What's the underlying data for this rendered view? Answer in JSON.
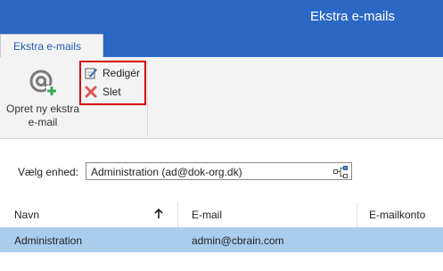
{
  "window": {
    "title": "Ekstra e-mails"
  },
  "tabs": [
    {
      "label": "Ekstra e-mails",
      "active": true
    }
  ],
  "ribbon": {
    "new_button": {
      "label": "Opret ny ekstra e-mail",
      "icon": "at-plus-icon"
    },
    "edit_button": {
      "label": "Redigér",
      "icon": "edit-icon"
    },
    "delete_button": {
      "label": "Slet",
      "icon": "delete-x-icon"
    }
  },
  "unit": {
    "label": "Vælg enhed:",
    "value": "Administration (ad@dok-org.dk)",
    "picker_icon": "org-tree-icon"
  },
  "table": {
    "columns": [
      "Navn",
      "E-mail",
      "E-mailkonto"
    ],
    "sort": {
      "column": "Navn",
      "direction": "ascending"
    },
    "rows": [
      {
        "name": "Administration",
        "email": "admin@cbrain.com",
        "account": "",
        "selected": true
      }
    ]
  },
  "colors": {
    "titlebar": "#2b68c6",
    "ribbon_bg": "#f3f3f3",
    "highlight_border": "#d60000",
    "selected_row": "#aacdee",
    "delete_red": "#e05555",
    "add_green": "#3aa655"
  }
}
